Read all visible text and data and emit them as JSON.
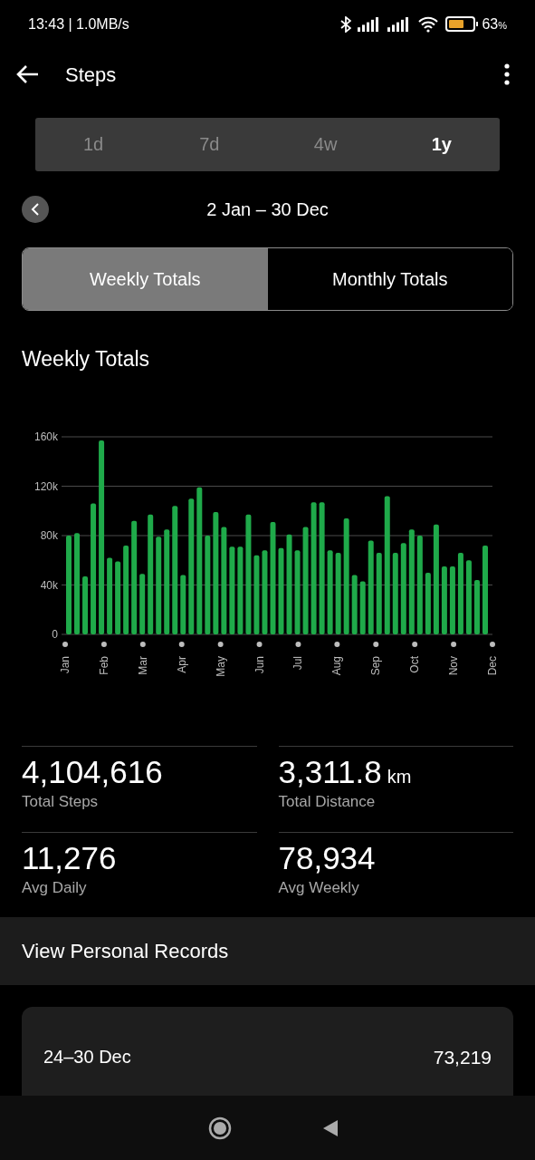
{
  "status_bar": {
    "time": "13:43 | 1.0MB/s",
    "battery": "63",
    "battery_unit": "%"
  },
  "header": {
    "title": "Steps"
  },
  "range_tabs": [
    {
      "label": "1d",
      "selected": false
    },
    {
      "label": "7d",
      "selected": false
    },
    {
      "label": "4w",
      "selected": false
    },
    {
      "label": "1y",
      "selected": true
    }
  ],
  "date_range": "2 Jan – 30 Dec",
  "view_toggle": [
    {
      "label": "Weekly Totals",
      "selected": true
    },
    {
      "label": "Monthly Totals",
      "selected": false
    }
  ],
  "section_title": "Weekly Totals",
  "chart_data": {
    "type": "bar",
    "grid": true,
    "values": [
      80000,
      82000,
      47000,
      106000,
      157000,
      62000,
      59000,
      72000,
      92000,
      49000,
      97000,
      79000,
      85000,
      104000,
      48000,
      110000,
      119000,
      80000,
      99000,
      87000,
      71000,
      71000,
      97000,
      64000,
      68000,
      91000,
      70000,
      81000,
      68000,
      87000,
      107000,
      107000,
      68000,
      66000,
      94000,
      48000,
      43000,
      76000,
      66000,
      112000,
      66000,
      74000,
      85000,
      80000,
      50000,
      89000,
      55000,
      55000,
      66000,
      60000,
      44000,
      72000
    ],
    "ylim": [
      0,
      160000
    ],
    "yticks": [
      {
        "value": 0,
        "label": "0"
      },
      {
        "value": 40000,
        "label": "40k"
      },
      {
        "value": 80000,
        "label": "80k"
      },
      {
        "value": 120000,
        "label": "120k"
      },
      {
        "value": 160000,
        "label": "160k"
      }
    ],
    "series": [
      {
        "color": "#1faa4a"
      }
    ]
  },
  "chart_month_labels": [
    "Jan",
    "Feb",
    "Mar",
    "Apr",
    "May",
    "Jun",
    "Jul",
    "Aug",
    "Sep",
    "Oct",
    "Nov",
    "Dec"
  ],
  "stats": [
    {
      "value": "4,104,616",
      "label": "Total Steps"
    },
    {
      "value": "3,311.8",
      "unit": "km",
      "label": "Total Distance"
    },
    {
      "value": "11,276",
      "label": "Avg Daily"
    },
    {
      "value": "78,934",
      "label": "Avg Weekly"
    }
  ],
  "personal_records_link": "View Personal Records",
  "week_card": {
    "range": "24–30 Dec",
    "total": "73,219"
  }
}
